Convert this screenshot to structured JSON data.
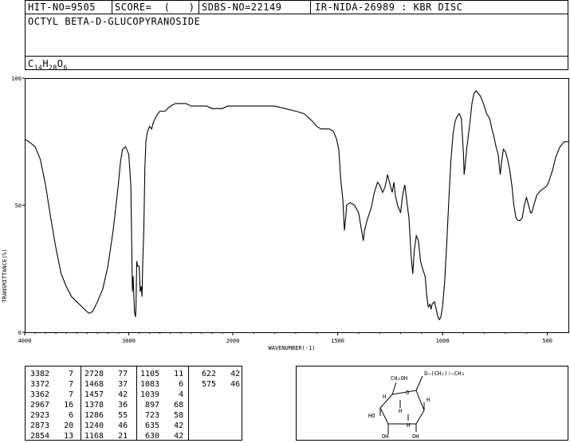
{
  "header": {
    "hit_no": "HIT-NO=9505",
    "score": "SCORE=  (   )",
    "sdbs_no": "SDBS-NO=22149",
    "ir_nida": "IR-NIDA-26989 : KBR DISC",
    "compound_name": "OCTYL BETA-D-GLUCOPYRANOSIDE",
    "formula": {
      "c": "C",
      "c_n": "14",
      "h": "H",
      "h_n": "28",
      "o": "O",
      "o_n": "6"
    }
  },
  "chart_data": {
    "type": "line",
    "xlabel": "WAVENUMBER(-1)",
    "ylabel": "TRANSMITTANCE(%)",
    "xlim": [
      4000,
      400
    ],
    "ylim": [
      0,
      100
    ],
    "x_ticks": [
      4000,
      3000,
      2000,
      1500,
      1000,
      500
    ],
    "y_ticks": [
      0,
      50,
      100
    ],
    "x_tick_labels": [
      "4000",
      "3000",
      "2000",
      "1500",
      "1000",
      "500"
    ],
    "y_tick_labels": [
      "0",
      "50",
      "100"
    ],
    "series": [
      {
        "points": [
          [
            4000,
            76
          ],
          [
            3960,
            75
          ],
          [
            3900,
            73
          ],
          [
            3850,
            68
          ],
          [
            3800,
            58
          ],
          [
            3750,
            45
          ],
          [
            3700,
            33
          ],
          [
            3650,
            23
          ],
          [
            3600,
            18
          ],
          [
            3550,
            14
          ],
          [
            3500,
            12
          ],
          [
            3450,
            10
          ],
          [
            3400,
            8
          ],
          [
            3380,
            7.5
          ],
          [
            3350,
            8
          ],
          [
            3300,
            12
          ],
          [
            3250,
            17
          ],
          [
            3200,
            26
          ],
          [
            3150,
            40
          ],
          [
            3100,
            58
          ],
          [
            3080,
            67
          ],
          [
            3060,
            72
          ],
          [
            3030,
            73
          ],
          [
            3000,
            70
          ],
          [
            2980,
            58
          ],
          [
            2965,
            16
          ],
          [
            2958,
            22
          ],
          [
            2945,
            8
          ],
          [
            2935,
            6
          ],
          [
            2930,
            10
          ],
          [
            2923,
            28
          ],
          [
            2915,
            26
          ],
          [
            2900,
            26
          ],
          [
            2890,
            16
          ],
          [
            2880,
            18
          ],
          [
            2873,
            14
          ],
          [
            2865,
            28
          ],
          [
            2855,
            40
          ],
          [
            2845,
            64
          ],
          [
            2835,
            75
          ],
          [
            2820,
            79
          ],
          [
            2800,
            81
          ],
          [
            2780,
            80
          ],
          [
            2760,
            83
          ],
          [
            2720,
            86
          ],
          [
            2700,
            87
          ],
          [
            2650,
            87
          ],
          [
            2600,
            89
          ],
          [
            2550,
            90
          ],
          [
            2500,
            90
          ],
          [
            2450,
            90
          ],
          [
            2400,
            89
          ],
          [
            2350,
            89
          ],
          [
            2300,
            89
          ],
          [
            2250,
            89
          ],
          [
            2200,
            88
          ],
          [
            2150,
            88
          ],
          [
            2100,
            88
          ],
          [
            2050,
            89
          ],
          [
            2000,
            89
          ],
          [
            1950,
            89
          ],
          [
            1900,
            89
          ],
          [
            1850,
            89
          ],
          [
            1800,
            89
          ],
          [
            1750,
            88
          ],
          [
            1700,
            87
          ],
          [
            1660,
            86
          ],
          [
            1620,
            83
          ],
          [
            1600,
            81
          ],
          [
            1580,
            80
          ],
          [
            1560,
            80
          ],
          [
            1540,
            80
          ],
          [
            1520,
            79
          ],
          [
            1505,
            76
          ],
          [
            1495,
            72
          ],
          [
            1485,
            60
          ],
          [
            1475,
            52
          ],
          [
            1468,
            40
          ],
          [
            1462,
            45
          ],
          [
            1457,
            50
          ],
          [
            1440,
            51
          ],
          [
            1420,
            50
          ],
          [
            1400,
            47
          ],
          [
            1390,
            42
          ],
          [
            1378,
            36
          ],
          [
            1372,
            40
          ],
          [
            1360,
            44
          ],
          [
            1340,
            49
          ],
          [
            1325,
            55
          ],
          [
            1310,
            59
          ],
          [
            1300,
            58
          ],
          [
            1286,
            55
          ],
          [
            1275,
            57
          ],
          [
            1262,
            62
          ],
          [
            1250,
            58
          ],
          [
            1240,
            55
          ],
          [
            1232,
            59
          ],
          [
            1225,
            54
          ],
          [
            1215,
            50
          ],
          [
            1200,
            47
          ],
          [
            1190,
            54
          ],
          [
            1180,
            58
          ],
          [
            1168,
            50
          ],
          [
            1160,
            45
          ],
          [
            1150,
            30
          ],
          [
            1142,
            23
          ],
          [
            1135,
            32
          ],
          [
            1125,
            38
          ],
          [
            1115,
            36
          ],
          [
            1105,
            28
          ],
          [
            1095,
            25
          ],
          [
            1083,
            22
          ],
          [
            1075,
            14
          ],
          [
            1068,
            10
          ],
          [
            1060,
            11
          ],
          [
            1055,
            9
          ],
          [
            1050,
            11
          ],
          [
            1039,
            12
          ],
          [
            1030,
            9
          ],
          [
            1022,
            6
          ],
          [
            1015,
            5
          ],
          [
            1008,
            6
          ],
          [
            1000,
            10
          ],
          [
            990,
            20
          ],
          [
            980,
            35
          ],
          [
            970,
            52
          ],
          [
            960,
            68
          ],
          [
            950,
            78
          ],
          [
            940,
            83
          ],
          [
            930,
            85
          ],
          [
            920,
            86
          ],
          [
            910,
            84
          ],
          [
            900,
            70
          ],
          [
            897,
            62
          ],
          [
            893,
            65
          ],
          [
            885,
            72
          ],
          [
            870,
            82
          ],
          [
            860,
            90
          ],
          [
            850,
            94
          ],
          [
            840,
            95
          ],
          [
            830,
            94
          ],
          [
            820,
            93
          ],
          [
            805,
            90
          ],
          [
            790,
            86
          ],
          [
            775,
            84
          ],
          [
            765,
            80
          ],
          [
            755,
            77
          ],
          [
            745,
            73
          ],
          [
            735,
            70
          ],
          [
            725,
            62
          ],
          [
            720,
            66
          ],
          [
            710,
            72
          ],
          [
            700,
            71
          ],
          [
            690,
            68
          ],
          [
            680,
            64
          ],
          [
            670,
            58
          ],
          [
            660,
            50
          ],
          [
            650,
            45
          ],
          [
            640,
            44
          ],
          [
            630,
            44
          ],
          [
            620,
            45
          ],
          [
            610,
            50
          ],
          [
            600,
            53
          ],
          [
            590,
            50
          ],
          [
            580,
            47
          ],
          [
            575,
            47
          ],
          [
            565,
            50
          ],
          [
            550,
            54
          ],
          [
            530,
            56
          ],
          [
            510,
            57
          ],
          [
            500,
            58
          ],
          [
            490,
            60
          ],
          [
            475,
            64
          ],
          [
            460,
            69
          ],
          [
            440,
            73
          ],
          [
            420,
            75
          ],
          [
            400,
            75
          ]
        ]
      }
    ]
  },
  "peak_table": [
    [
      [
        "3382",
        "7"
      ],
      [
        "3372",
        "7"
      ],
      [
        "3362",
        "7"
      ],
      [
        "2967",
        "16"
      ],
      [
        "2923",
        "6"
      ],
      [
        "2873",
        "20"
      ],
      [
        "2854",
        "13"
      ]
    ],
    [
      [
        "2728",
        "77"
      ],
      [
        "1468",
        "37"
      ],
      [
        "1457",
        "42"
      ],
      [
        "1378",
        "36"
      ],
      [
        "1286",
        "55"
      ],
      [
        "1240",
        "46"
      ],
      [
        "1168",
        "21"
      ]
    ],
    [
      [
        "1105",
        "11"
      ],
      [
        "1083",
        "6"
      ],
      [
        "1039",
        "4"
      ],
      [
        "897",
        "68"
      ],
      [
        "723",
        "58"
      ],
      [
        "635",
        "42"
      ],
      [
        "630",
        "42"
      ]
    ],
    [
      [
        "622",
        "42"
      ],
      [
        "575",
        "46"
      ]
    ]
  ],
  "structure": {
    "ch2oh": "CH₂OH",
    "chain": "O—(CH₂)₇—CH₃",
    "h": "H",
    "ho": "HO",
    "oh": "OH",
    "o": "O"
  }
}
